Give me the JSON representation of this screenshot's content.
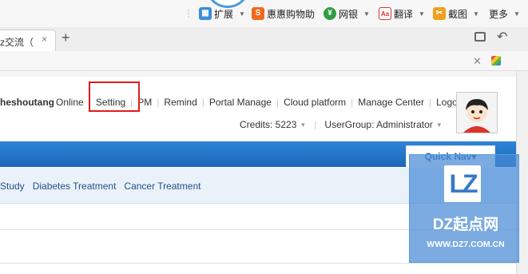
{
  "extension_bar": {
    "items": [
      {
        "label": "扩展",
        "icon": "grid-extension-icon",
        "color": "#3b8dd8"
      },
      {
        "label": "惠惠购物助",
        "icon": "shopping-assistant-icon",
        "color": "#f06a1c"
      },
      {
        "label": "网银",
        "icon": "bank-shield-icon",
        "color": "#2f9e44"
      },
      {
        "label": "翻译",
        "icon": "translate-icon",
        "color": "#e03131"
      },
      {
        "label": "截图",
        "icon": "screenshot-icon",
        "color": "#f0a020"
      },
      {
        "label": "更多",
        "icon": "more-icon",
        "color": "#555555"
      }
    ]
  },
  "browser": {
    "tab_title": "z交流（",
    "tab_close": "×",
    "new_tab": "+"
  },
  "user": {
    "name": "heshoutang",
    "status": "Online",
    "links": [
      "Setting",
      "PM",
      "Remind",
      "Portal Manage",
      "Cloud platform",
      "Manage Center",
      "Logout"
    ],
    "credits": "Credits: 5223",
    "usergroup": "UserGroup: Administrator"
  },
  "nav": {
    "quick_nav": "Quick Nav▾"
  },
  "sub_nav": {
    "links": [
      "Study",
      "Diabetes Treatment",
      "Cancer Treatment"
    ]
  },
  "watermark": {
    "logo": "LZ",
    "text": "DZ起点网",
    "url": "WWW.DZ7.COM.CN"
  },
  "colors": {
    "nav_blue": "#1f6fc2",
    "highlight_red": "#e21b1b",
    "link_blue": "#274e8e"
  }
}
